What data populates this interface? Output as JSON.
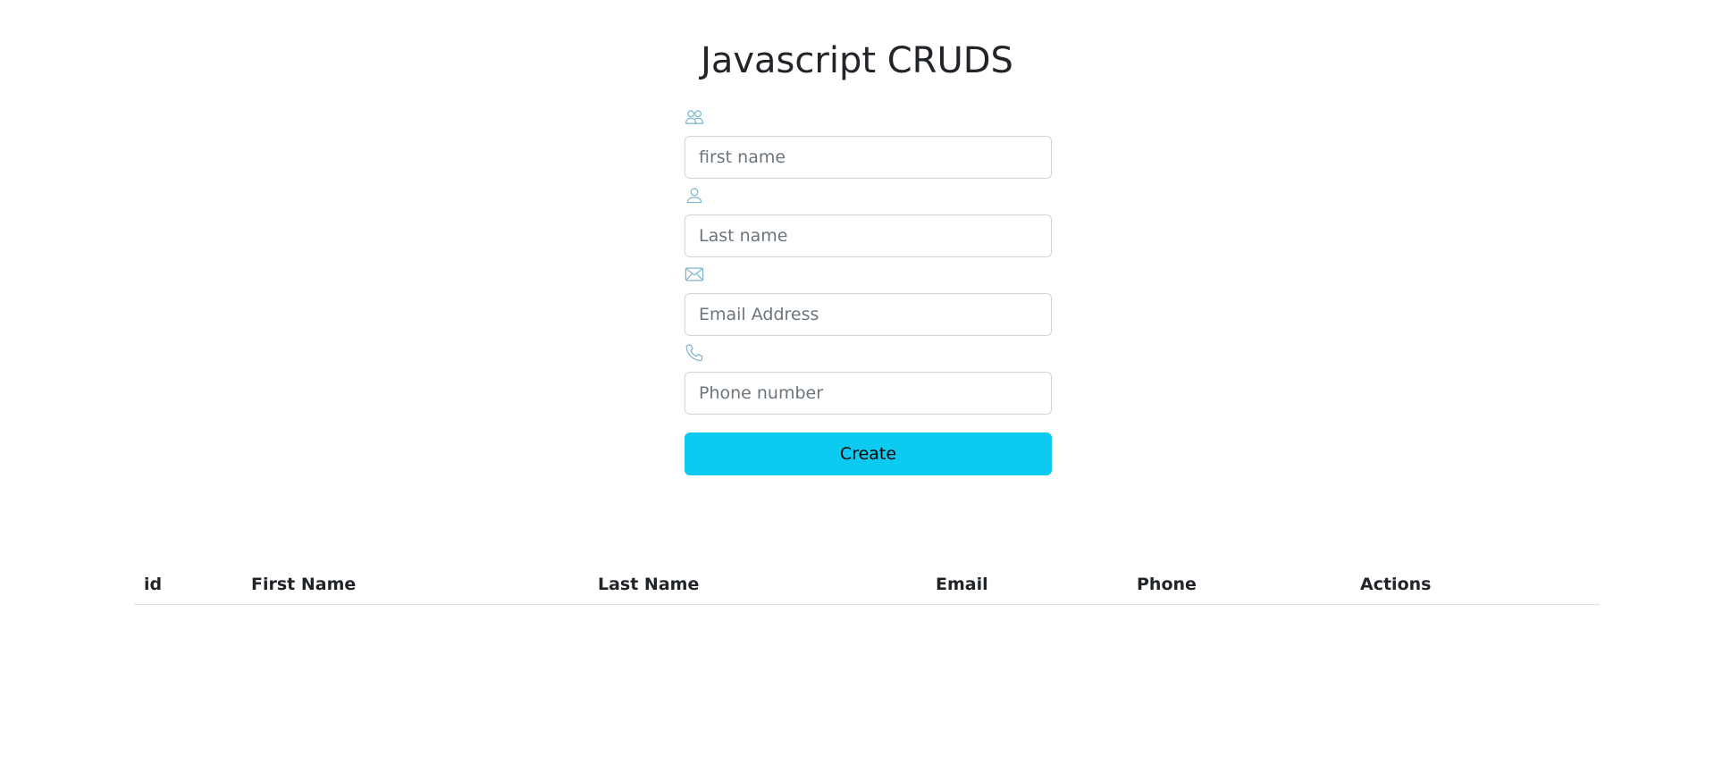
{
  "page": {
    "title": "Javascript CRUDS"
  },
  "form": {
    "fields": [
      {
        "icon": "people-icon",
        "placeholder": "first name",
        "value": ""
      },
      {
        "icon": "person-icon",
        "placeholder": "Last name",
        "value": ""
      },
      {
        "icon": "envelope-icon",
        "placeholder": "Email Address",
        "value": ""
      },
      {
        "icon": "telephone-icon",
        "placeholder": "Phone number",
        "value": ""
      }
    ],
    "submit_label": "Create",
    "icon_color": "#0dcaf0",
    "button_color": "#0dcaf0"
  },
  "table": {
    "columns": [
      "id",
      "First Name",
      "Last Name",
      "Email",
      "Phone",
      "Actions"
    ],
    "rows": []
  }
}
